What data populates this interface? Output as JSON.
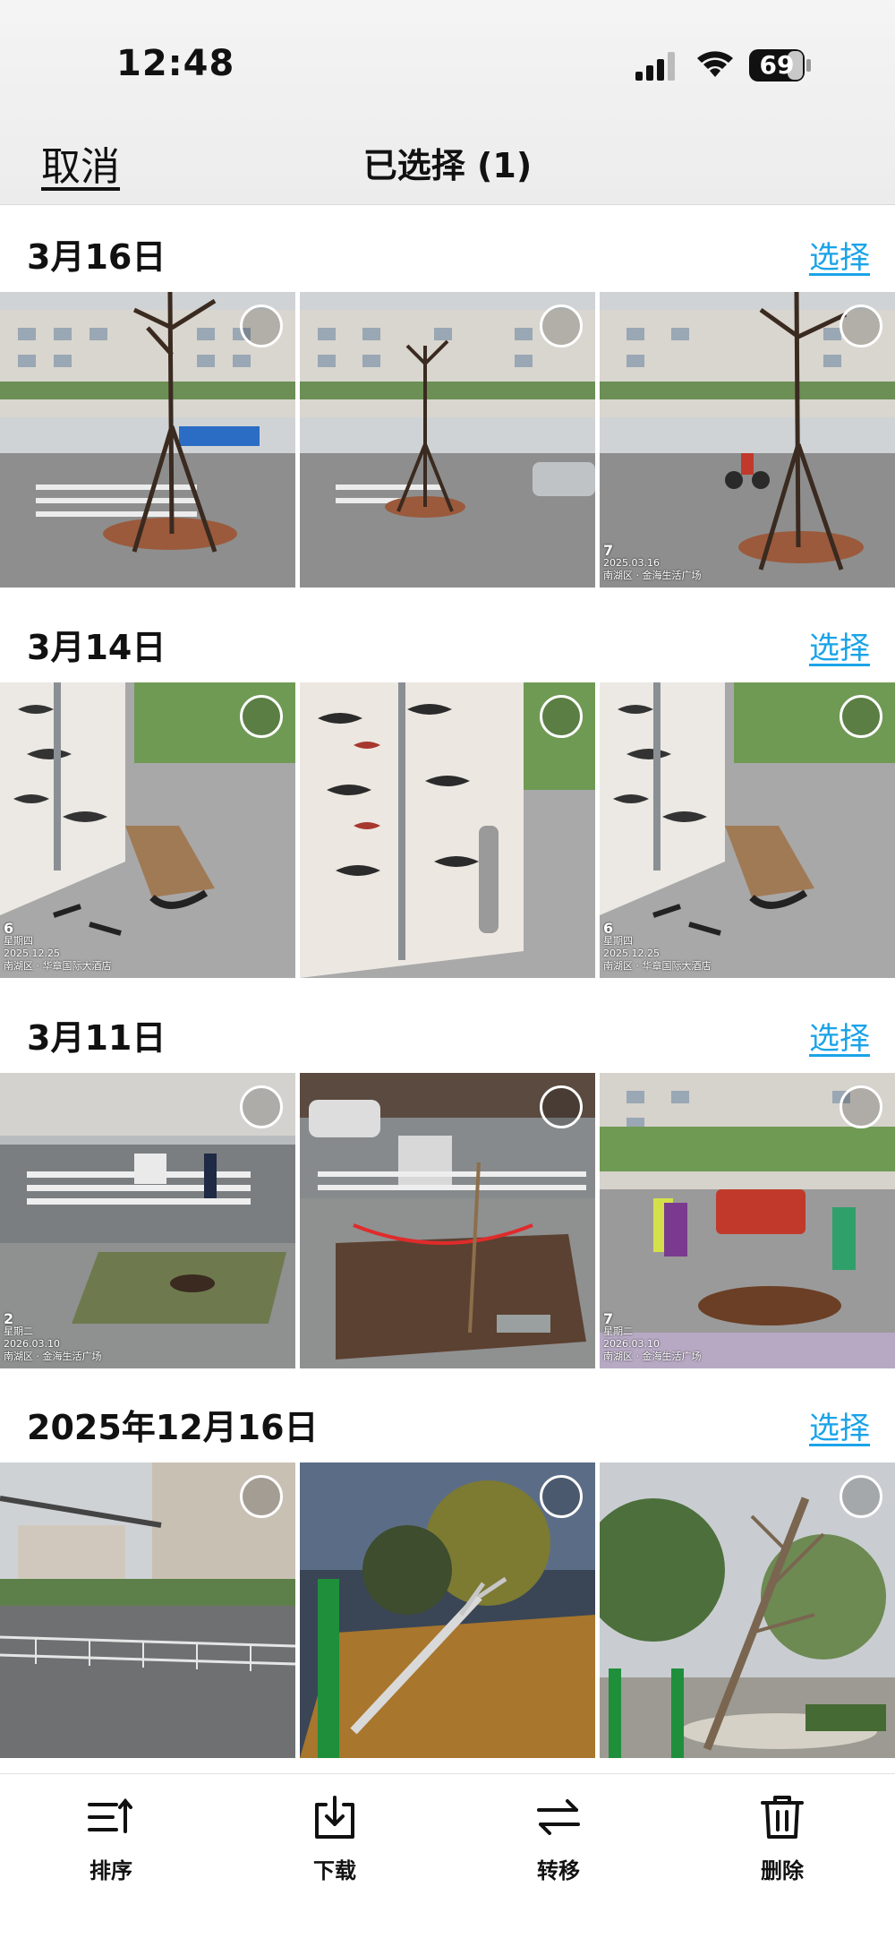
{
  "status": {
    "time": "12:48",
    "battery": "69"
  },
  "nav": {
    "cancel": "取消",
    "title": "已选择 (1)"
  },
  "sections": [
    {
      "date": "3月16日",
      "select": "选择",
      "photos": [
        {
          "desc": "street tree with supports"
        },
        {
          "desc": "street tree with supports and car"
        },
        {
          "desc": "street tree with cyclist",
          "watermark": {
            "day": "7",
            "date": "2025.03.16",
            "place": "南湖区 · 金海生活广场"
          }
        }
      ]
    },
    {
      "date": "3月14日",
      "select": "选择",
      "photos": [
        {
          "desc": "broken bench by decorative wall",
          "watermark": {
            "day": "6",
            "week": "星期四",
            "date": "2025.12.25",
            "place": "南湖区 · 华章国际大酒店"
          }
        },
        {
          "desc": "decorative wall with bollards"
        },
        {
          "desc": "broken bench by decorative wall",
          "watermark": {
            "day": "6",
            "week": "星期四",
            "date": "2025.12.25",
            "place": "南湖区 · 华章国际大酒店"
          }
        }
      ]
    },
    {
      "date": "3月11日",
      "select": "选择",
      "photos": [
        {
          "desc": "tree stump at crosswalk",
          "watermark": {
            "day": "2",
            "week": "星期二",
            "date": "2026.03.10",
            "place": "南湖区 · 金海生活广场"
          }
        },
        {
          "desc": "dug planting pit with tape"
        },
        {
          "desc": "workers digging pit",
          "watermark": {
            "day": "7",
            "week": "星期二",
            "date": "2026.03.10",
            "place": "南湖区 · 金海生活广场"
          }
        }
      ]
    },
    {
      "date": "2025年12月16日",
      "select": "选择",
      "photos": [
        {
          "desc": "street with railing and traffic light"
        },
        {
          "desc": "fallen tree at night in park"
        },
        {
          "desc": "leaning tree in plaza"
        }
      ]
    }
  ],
  "toolbar": [
    {
      "label": "排序",
      "icon": "sort-icon"
    },
    {
      "label": "下载",
      "icon": "download-icon"
    },
    {
      "label": "转移",
      "icon": "transfer-icon"
    },
    {
      "label": "删除",
      "icon": "trash-icon"
    }
  ],
  "colors": {
    "accent": "#1aa3e8",
    "text": "#111111"
  }
}
